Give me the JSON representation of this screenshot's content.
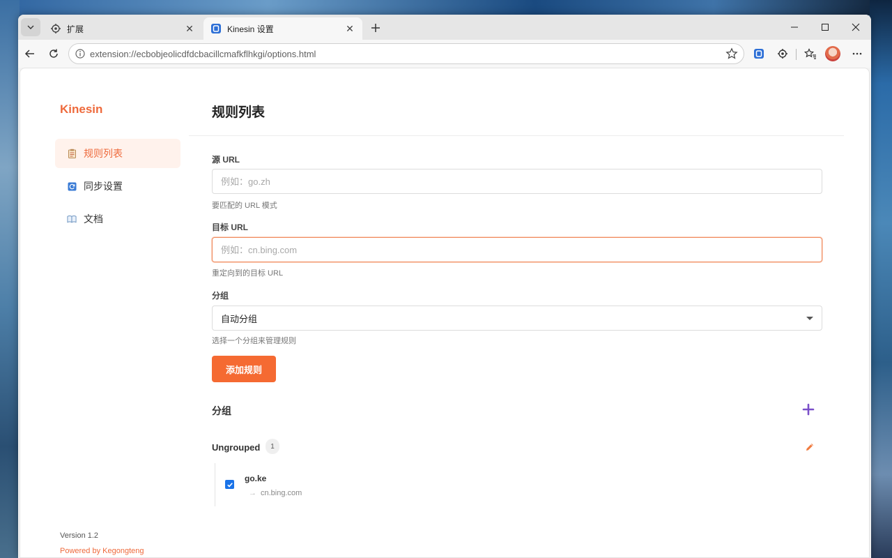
{
  "browser": {
    "tabs": [
      {
        "title": "扩展",
        "icon": "puzzle-gear-icon",
        "active": false
      },
      {
        "title": "Kinesin 设置",
        "icon": "kinesin-extension-icon",
        "active": true
      }
    ],
    "address_url": "extension://ecbobjeolicdfdcbacillcmafkflhkgi/options.html",
    "toolbar_icons": [
      "back-icon",
      "reload-icon",
      "star-icon",
      "kinesin-extension-icon",
      "extensions-puzzle-icon",
      "favorites-icon",
      "profile-avatar",
      "more-icon"
    ],
    "window_controls": [
      "minimize-icon",
      "maximize-icon",
      "close-icon"
    ]
  },
  "sidebar": {
    "brand": "Kinesin",
    "items": [
      {
        "label": "规则列表",
        "icon": "clipboard-icon",
        "active": true
      },
      {
        "label": "同步设置",
        "icon": "sync-icon",
        "active": false
      },
      {
        "label": "文档",
        "icon": "book-icon",
        "active": false
      }
    ],
    "version": "Version 1.2",
    "powered_by": "Powered by Kegongteng"
  },
  "main": {
    "title": "规则列表",
    "form": {
      "source": {
        "label": "源 URL",
        "placeholder": "例如：go.zh",
        "help": "要匹配的 URL 模式"
      },
      "target": {
        "label": "目标 URL",
        "placeholder": "例如：cn.bing.com",
        "help": "重定向到的目标 URL"
      },
      "group": {
        "label": "分组",
        "selected": "自动分组",
        "help": "选择一个分组来管理规则"
      },
      "submit_label": "添加规则"
    },
    "groups_section": {
      "title": "分组",
      "groups": [
        {
          "name": "Ungrouped",
          "count": "1",
          "rules": [
            {
              "source": "go.ke",
              "target": "cn.bing.com",
              "enabled": true
            }
          ]
        }
      ]
    }
  },
  "colors": {
    "accent": "#f56a32",
    "accent_text": "#ee6a3c",
    "active_nav_bg": "#fff2ec",
    "add_icon": "#7a4fc9",
    "checkbox": "#1a73e8"
  }
}
